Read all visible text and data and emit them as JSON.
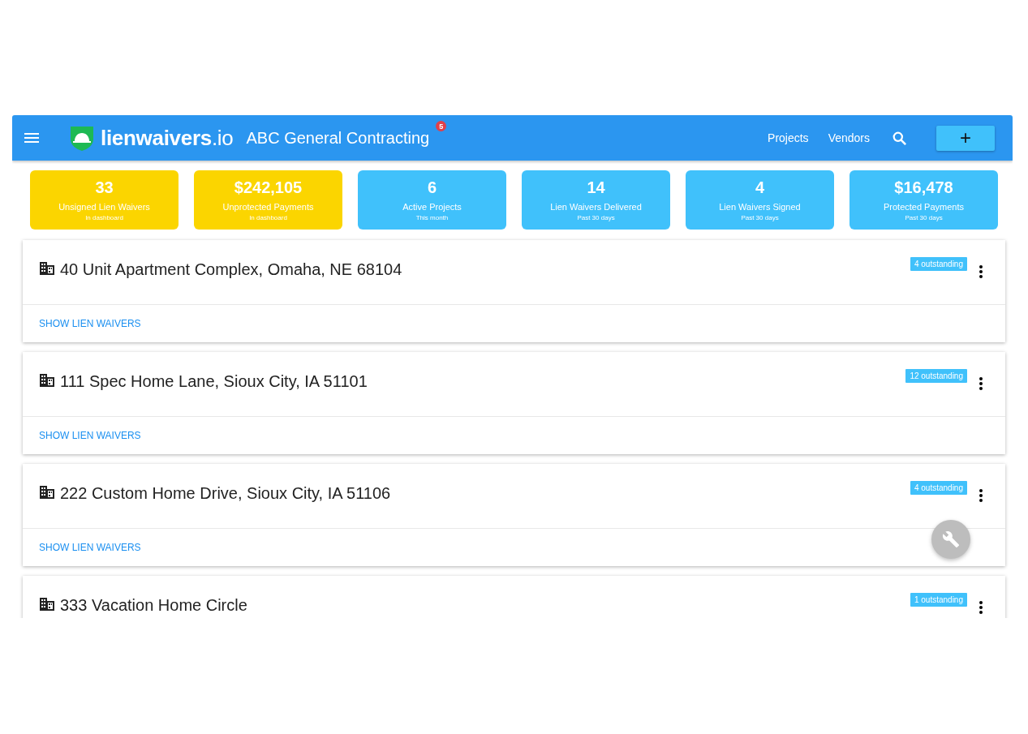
{
  "header": {
    "logo_text": "lienwaivers",
    "logo_suffix": ".io",
    "company": "ABC General Contracting",
    "notification_count": "5",
    "nav": [
      "Projects",
      "Vendors"
    ],
    "add_button": "+"
  },
  "stats": [
    {
      "value": "33",
      "label": "Unsigned Lien Waivers",
      "period": "In dashboard",
      "color": "#fbd500"
    },
    {
      "value": "$242,105",
      "label": "Unprotected Payments",
      "period": "In dashboard",
      "color": "#fbd500"
    },
    {
      "value": "6",
      "label": "Active Projects",
      "period": "This month",
      "color": "#40c1fb"
    },
    {
      "value": "14",
      "label": "Lien Waivers Delivered",
      "period": "Past 30 days",
      "color": "#40c1fb"
    },
    {
      "value": "4",
      "label": "Lien Waivers Signed",
      "period": "Past 30 days",
      "color": "#40c1fb"
    },
    {
      "value": "$16,478",
      "label": "Protected Payments",
      "period": "Past 30 days",
      "color": "#40c1fb"
    }
  ],
  "projects": [
    {
      "name": "40 Unit Apartment Complex, Omaha, NE 68104",
      "badge": "4 outstanding",
      "action": "SHOW LIEN WAIVERS"
    },
    {
      "name": "111 Spec Home Lane, Sioux City, IA 51101",
      "badge": "12 outstanding",
      "action": "SHOW LIEN WAIVERS"
    },
    {
      "name": "222 Custom Home Drive, Sioux City, IA 51106",
      "badge": "4 outstanding",
      "action": "SHOW LIEN WAIVERS"
    },
    {
      "name": "333 Vacation Home Circle",
      "badge": "1 outstanding"
    }
  ]
}
